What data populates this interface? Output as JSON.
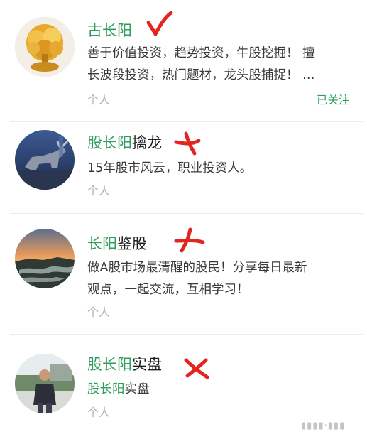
{
  "accounts": [
    {
      "name_highlight": "古长阳",
      "name_rest": "",
      "desc_lines": [
        "善于价值投资，趋势投资，牛股挖掘！ 擅",
        "长波段投资，热门题材，龙头股捕捉！ …"
      ],
      "type": "个人",
      "follow": "已关注",
      "mark": "check",
      "avatar": "money-tree"
    },
    {
      "name_highlight": "股长阳",
      "name_rest": "擒龙",
      "desc_lines": [
        "15年股市风云，职业投资人。"
      ],
      "type": "个人",
      "follow": "",
      "mark": "cross",
      "avatar": "bull"
    },
    {
      "name_highlight": "长阳",
      "name_rest": "鉴股",
      "desc_lines": [
        "做A股市场最清醒的股民！分享每日最新",
        "观点，一起交流，互相学习！"
      ],
      "type": "个人",
      "follow": "",
      "mark": "cross",
      "avatar": "sunset"
    },
    {
      "name_highlight": "股长阳",
      "name_rest": "实盘",
      "desc_highlight": "股长阳",
      "desc_rest": "实盘",
      "type": "个人",
      "follow": "",
      "mark": "cross",
      "avatar": "person"
    }
  ],
  "colors": {
    "accent": "#2f9f5e",
    "mark": "#e3251f",
    "muted": "#b0b0b0"
  }
}
